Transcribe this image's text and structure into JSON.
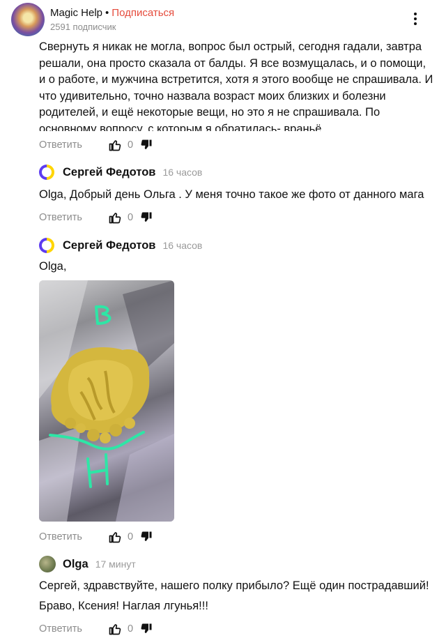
{
  "header": {
    "channel_name": "Magic Help",
    "separator": "•",
    "subscribe_label": "Подписаться",
    "subscribers": "2591 подписчик"
  },
  "colors": {
    "subscribe": "#e54b3c",
    "muted": "#8c8c8c",
    "annotation_green": "#2ee6a6"
  },
  "comments": [
    {
      "text": "Свернуть я никак не могла, вопрос был острый, сегодня гадали, завтра решали, она просто сказала от балды. Я все возмущалась, и о помощи, и о работе, и мужчина встретится, хотя я этого вообще не спрашивала. И что удивительно, точно назвала возраст моих близких и болезни родителей, и ещё некоторые вещи, но это я не спрашивала. По основному вопросу, с которым я обратилась- враньё",
      "reply_label": "Ответить",
      "likes": "0"
    },
    {
      "author": "Сергей Федотов",
      "time": "16 часов",
      "text": "Olga, Добрый день Ольга . У меня точно такое же фото от данного мага",
      "reply_label": "Ответить",
      "likes": "0"
    },
    {
      "author": "Сергей Федотов",
      "time": "16 часов",
      "text": "Olga,",
      "image_annotations": [
        "В",
        "Н"
      ],
      "reply_label": "Ответить",
      "likes": "0"
    },
    {
      "author": "Olga",
      "time": "17 минут",
      "text_line1": "Сергей, здравствуйте, нашего полку прибыло? Ещё один пострадавший!",
      "text_line2": "Браво, Ксения! Наглая лгунья!!!",
      "reply_label": "Ответить",
      "likes": "0"
    }
  ],
  "icons": [
    "thumb-up-icon",
    "thumb-down-icon",
    "kebab-menu-icon"
  ]
}
